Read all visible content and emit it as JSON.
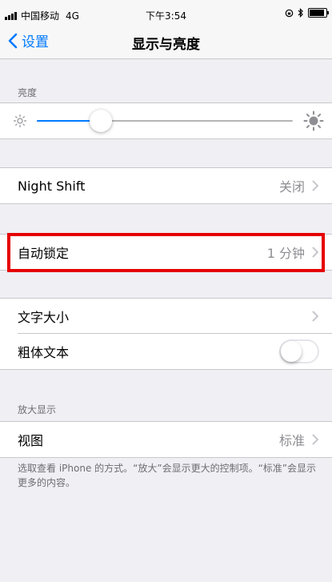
{
  "status_bar": {
    "carrier": "中国移动",
    "network": "4G",
    "time": "下午3:54"
  },
  "nav": {
    "back_label": "设置",
    "title": "显示与亮度"
  },
  "brightness": {
    "header": "亮度",
    "level_percent": 25
  },
  "night_shift": {
    "label": "Night Shift",
    "value": "关闭"
  },
  "auto_lock": {
    "label": "自动锁定",
    "value": "1 分钟"
  },
  "text": {
    "text_size_label": "文字大小",
    "bold_text_label": "粗体文本",
    "bold_text_on": false
  },
  "zoom": {
    "header": "放大显示",
    "view_label": "视图",
    "view_value": "标准",
    "note": "选取查看 iPhone 的方式。“放大”会显示更大的控制项。“标准”会显示更多的内容。"
  },
  "colors": {
    "accent": "#007aff",
    "highlight": "#e60000",
    "background": "#efeff4"
  }
}
